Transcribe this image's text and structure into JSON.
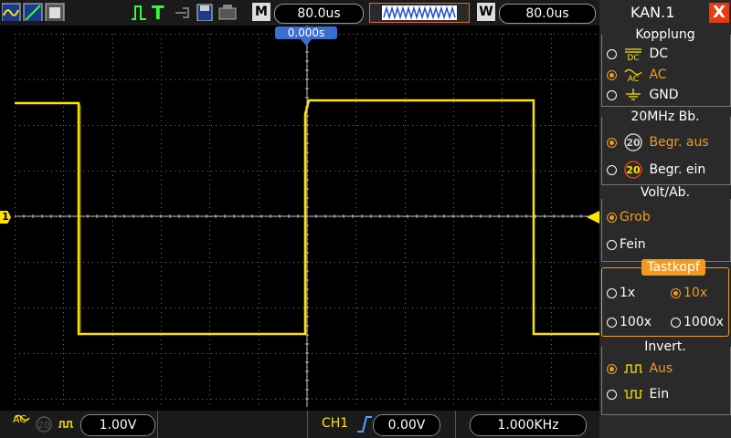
{
  "toolbar": {
    "mode_label": "M",
    "timebase": "80.0us",
    "window_label": "W",
    "window_timebase": "80.0us",
    "trigger_indicator": "T"
  },
  "screen": {
    "trigger_position": "0.000s",
    "channel_marker": "1",
    "signal_color": "#ffe400"
  },
  "bottom": {
    "coupling_icon": "AC",
    "ch1_scale": "1.00V",
    "trigger_source": "CH1",
    "trigger_level": "0.00V",
    "frequency": "1.000KHz"
  },
  "menu": {
    "title": "KAN.1",
    "close_label": "X",
    "accent_color": "#f29a1f",
    "kopplung": {
      "header": "Kopplung",
      "options": [
        {
          "label": "DC",
          "selected": false
        },
        {
          "label": "AC",
          "selected": true
        },
        {
          "label": "GND",
          "selected": false
        }
      ]
    },
    "bandwidth": {
      "header": "20MHz  Bb.",
      "options": [
        {
          "label": "Begr.  aus",
          "selected": true
        },
        {
          "label": "Begr.  ein",
          "selected": false
        }
      ]
    },
    "volt": {
      "header": "Volt/Ab.",
      "options": [
        {
          "label": "Grob",
          "selected": true
        },
        {
          "label": "Fein",
          "selected": false
        }
      ]
    },
    "tastkopf": {
      "header": "Tastkopf",
      "options": [
        {
          "label": "1x",
          "selected": false
        },
        {
          "label": "10x",
          "selected": true
        },
        {
          "label": "100x",
          "selected": false
        },
        {
          "label": "1000x",
          "selected": false
        }
      ]
    },
    "invert": {
      "header": "Invert.",
      "options": [
        {
          "label": "Aus",
          "selected": true
        },
        {
          "label": "Ein",
          "selected": false
        }
      ]
    }
  }
}
